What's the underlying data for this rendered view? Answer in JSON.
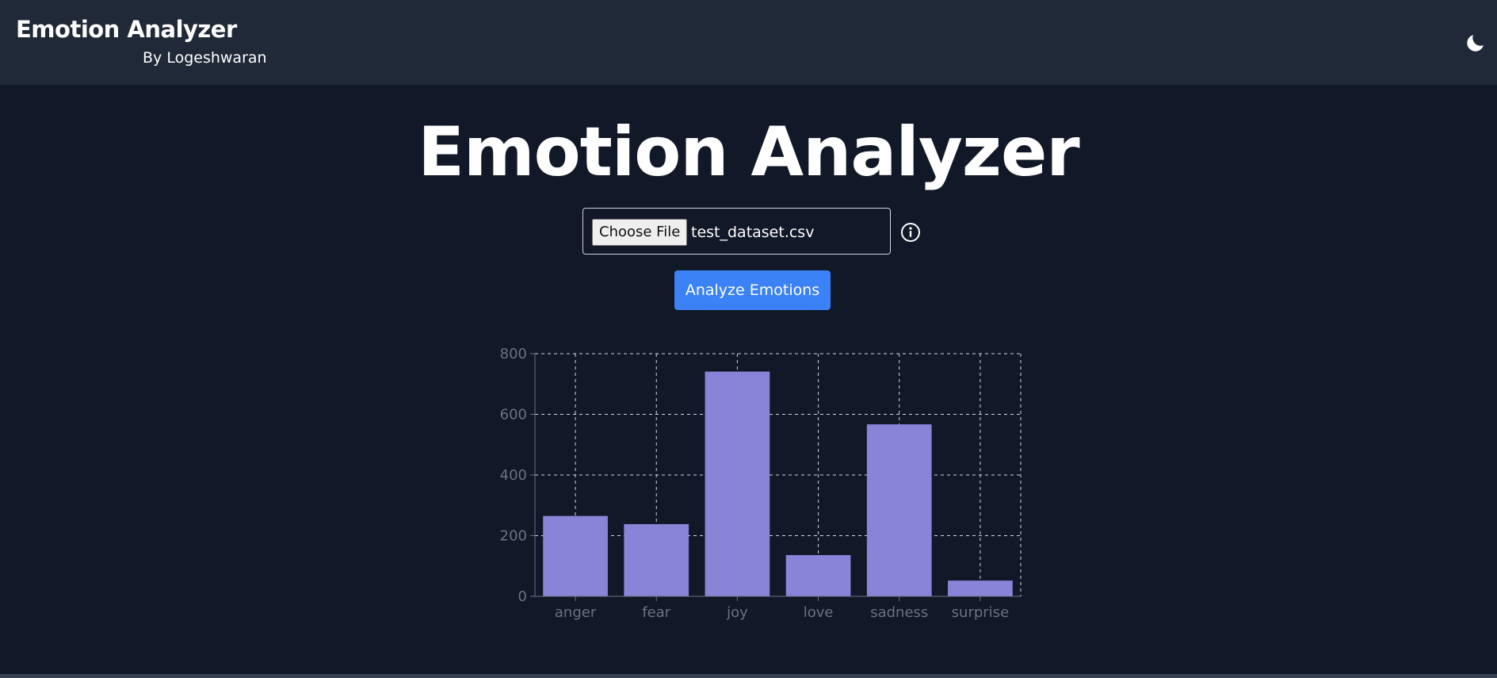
{
  "navbar": {
    "title": "Emotion Analyzer",
    "subtitle": "By Logeshwaran",
    "theme_icon": "moon-icon"
  },
  "main": {
    "heading": "Emotion Analyzer",
    "file_input": {
      "button_label": "Choose File",
      "file_name": "test_dataset.csv"
    },
    "info_icon": "info-icon",
    "analyze_label": "Analyze Emotions"
  },
  "colors": {
    "background": "#111827",
    "navbar": "#1f2937",
    "accent": "#3b82f6",
    "bar": "#8884d8",
    "axis_text": "#6b7280"
  },
  "chart_data": {
    "type": "bar",
    "categories": [
      "anger",
      "fear",
      "joy",
      "love",
      "sadness",
      "surprise"
    ],
    "values": [
      265,
      238,
      741,
      136,
      567,
      52
    ],
    "ylim": [
      0,
      800
    ],
    "yticks": [
      0,
      200,
      400,
      600,
      800
    ],
    "grid": true,
    "grid_style": "dashed",
    "legend": "none",
    "title": "",
    "xlabel": "",
    "ylabel": ""
  }
}
